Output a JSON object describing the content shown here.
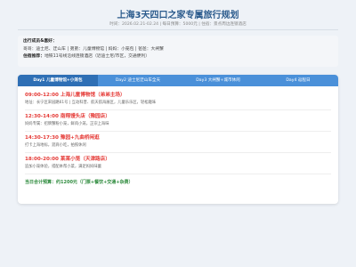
{
  "header": {
    "title": "上海3天四口之家专属旅行规划",
    "subtitle": "时间：2026.02.21-02.24 | 每日预算：5000元 | 住宿：景点周边连锁酒店"
  },
  "info": {
    "members_label": "出行成员&喜好：",
    "members_text": "哥哥：迪士尼、迂山车 | 弟弟：儿童博物馆 | 妈妈：小笼包 | 爸爸：大闸蟹",
    "lodging_label": "住宿推荐：",
    "lodging_text": "地铁11号线沿线连锁酒店（近迪士尼/市区，交通便利）"
  },
  "tabs": [
    {
      "label": "Day1 儿童博物馆+小笼包"
    },
    {
      "label": "Day2 迪士尼迂山车全天"
    },
    {
      "label": "Day3 大闸蟹+城市休闲"
    },
    {
      "label": "Day4 返程日"
    }
  ],
  "schedule": [
    {
      "title": "09:00-12:00 上海儿童博物馆（弟弟主场）",
      "desc": "地址：长宁区宋园路61号 | 互动科普、航天航海展区，儿童乐乐区，轻松趣味"
    },
    {
      "title": "12:30-14:00 南翔馒头店（豫园店）",
      "desc": "妈妈专属：招牌蟹粉小笼，鲜肉小笼，正宗上海味"
    },
    {
      "title": "14:30-17:30 豫园+九曲桥闲逛",
      "desc": "打卡上海地标，逛商小吃，拍照休闲"
    },
    {
      "title": "18:00-20:00 莱莱小笼（天津路店）",
      "desc": "追加小笼体验，搭配本帮小菜，满足妈妈味蕾"
    }
  ],
  "total": "当日合计预算：约1200元（门票+餐饮+交通+杂费）",
  "colors": {
    "accent": "#2e6fb5",
    "tab_bar": "#4a90d9",
    "time_red": "#e53935",
    "total_green": "#2e8b3d",
    "title_blue": "#2a5a8c"
  }
}
